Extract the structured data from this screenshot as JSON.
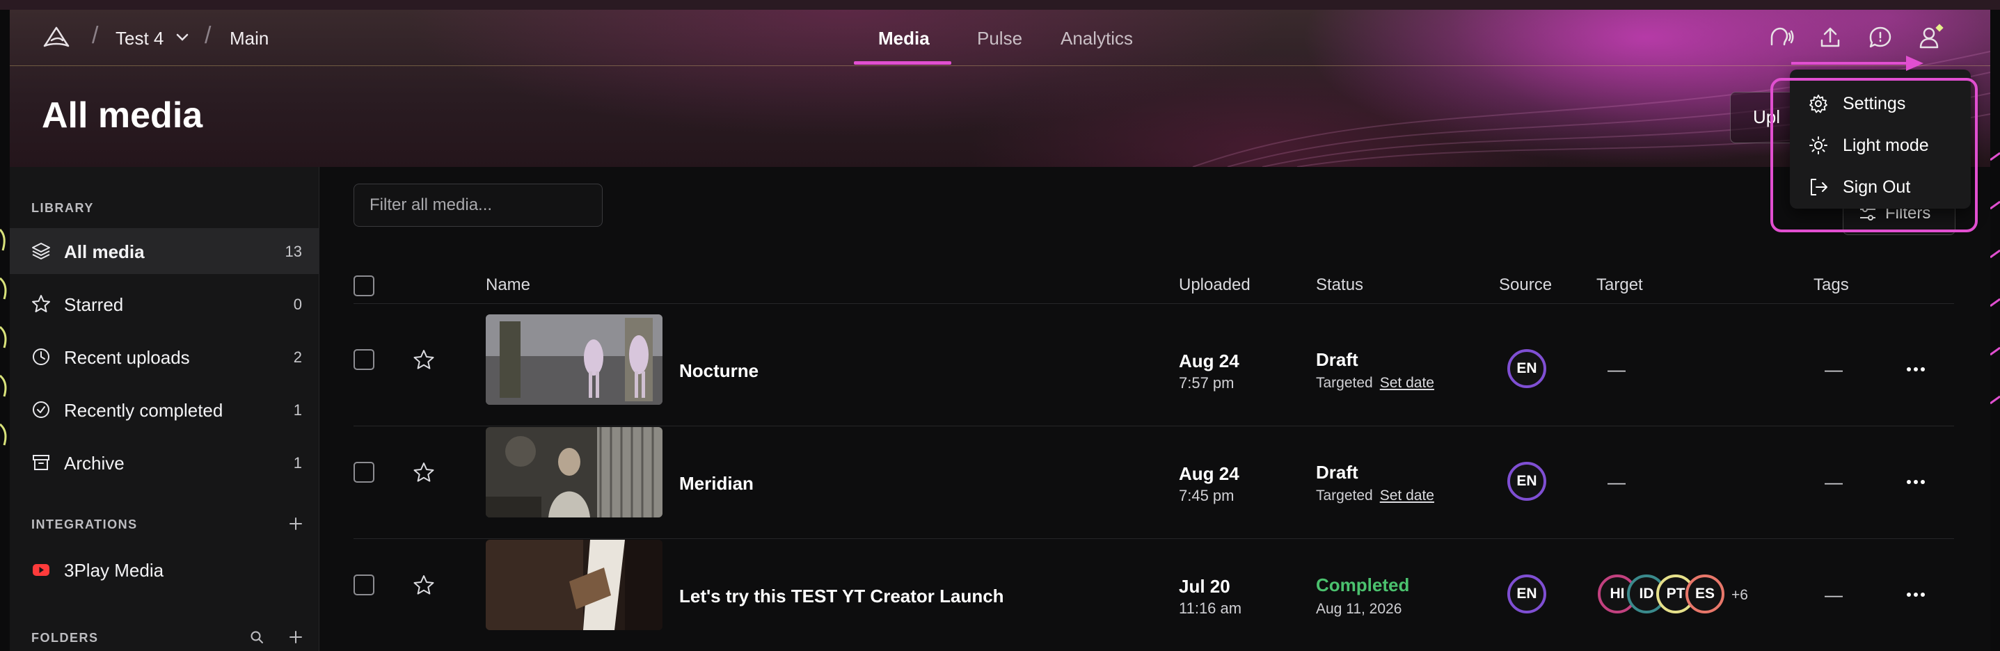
{
  "topbar": {
    "project": "Test 4",
    "workspace": "Main",
    "tabs": [
      {
        "label": "Media",
        "active": true
      },
      {
        "label": "Pulse",
        "active": false
      },
      {
        "label": "Analytics",
        "active": false
      }
    ]
  },
  "page": {
    "title": "All media",
    "upload_label": "Upl"
  },
  "sidebar": {
    "library_heading": "LIBRARY",
    "items": [
      {
        "label": "All media",
        "count": "13",
        "icon": "layers-icon",
        "active": true
      },
      {
        "label": "Starred",
        "count": "0",
        "icon": "star-icon"
      },
      {
        "label": "Recent uploads",
        "count": "2",
        "icon": "clock-icon"
      },
      {
        "label": "Recently completed",
        "count": "1",
        "icon": "check-circle-icon"
      },
      {
        "label": "Archive",
        "count": "1",
        "icon": "archive-icon"
      }
    ],
    "integrations_heading": "INTEGRATIONS",
    "integrations": [
      {
        "label": "3Play Media",
        "icon": "youtube-icon"
      }
    ],
    "folders_heading": "FOLDERS"
  },
  "main": {
    "filter_placeholder": "Filter all media...",
    "filters_label": "Filters",
    "columns": {
      "name": "Name",
      "uploaded": "Uploaded",
      "status": "Status",
      "source": "Source",
      "target": "Target",
      "tags": "Tags"
    },
    "rows": [
      {
        "name": "Nocturne",
        "date": "Aug 24",
        "time": "7:57 pm",
        "status": "Draft",
        "status_sub": "Targeted",
        "set_date": "Set date",
        "source": "EN",
        "target": "—",
        "tags": "—"
      },
      {
        "name": "Meridian",
        "date": "Aug 24",
        "time": "7:45 pm",
        "status": "Draft",
        "status_sub": "Targeted",
        "set_date": "Set date",
        "source": "EN",
        "target": "—",
        "tags": "—"
      },
      {
        "name": "Let's try this TEST YT Creator Launch",
        "date": "Jul 20",
        "time": "11:16 am",
        "status": "Completed",
        "status_sub": "Aug 11, 2026",
        "source": "EN",
        "targets": [
          "HI",
          "ID",
          "PT",
          "ES"
        ],
        "targets_more": "+6",
        "tags": "—"
      }
    ]
  },
  "user_menu": {
    "items": [
      {
        "label": "Settings",
        "icon": "gear-icon"
      },
      {
        "label": "Light mode",
        "icon": "sun-icon"
      },
      {
        "label": "Sign Out",
        "icon": "sign-out-icon"
      }
    ]
  },
  "colors": {
    "accent": "#e14fd0",
    "completed": "#4bc16e",
    "source_ring": "#7f4fd3"
  }
}
